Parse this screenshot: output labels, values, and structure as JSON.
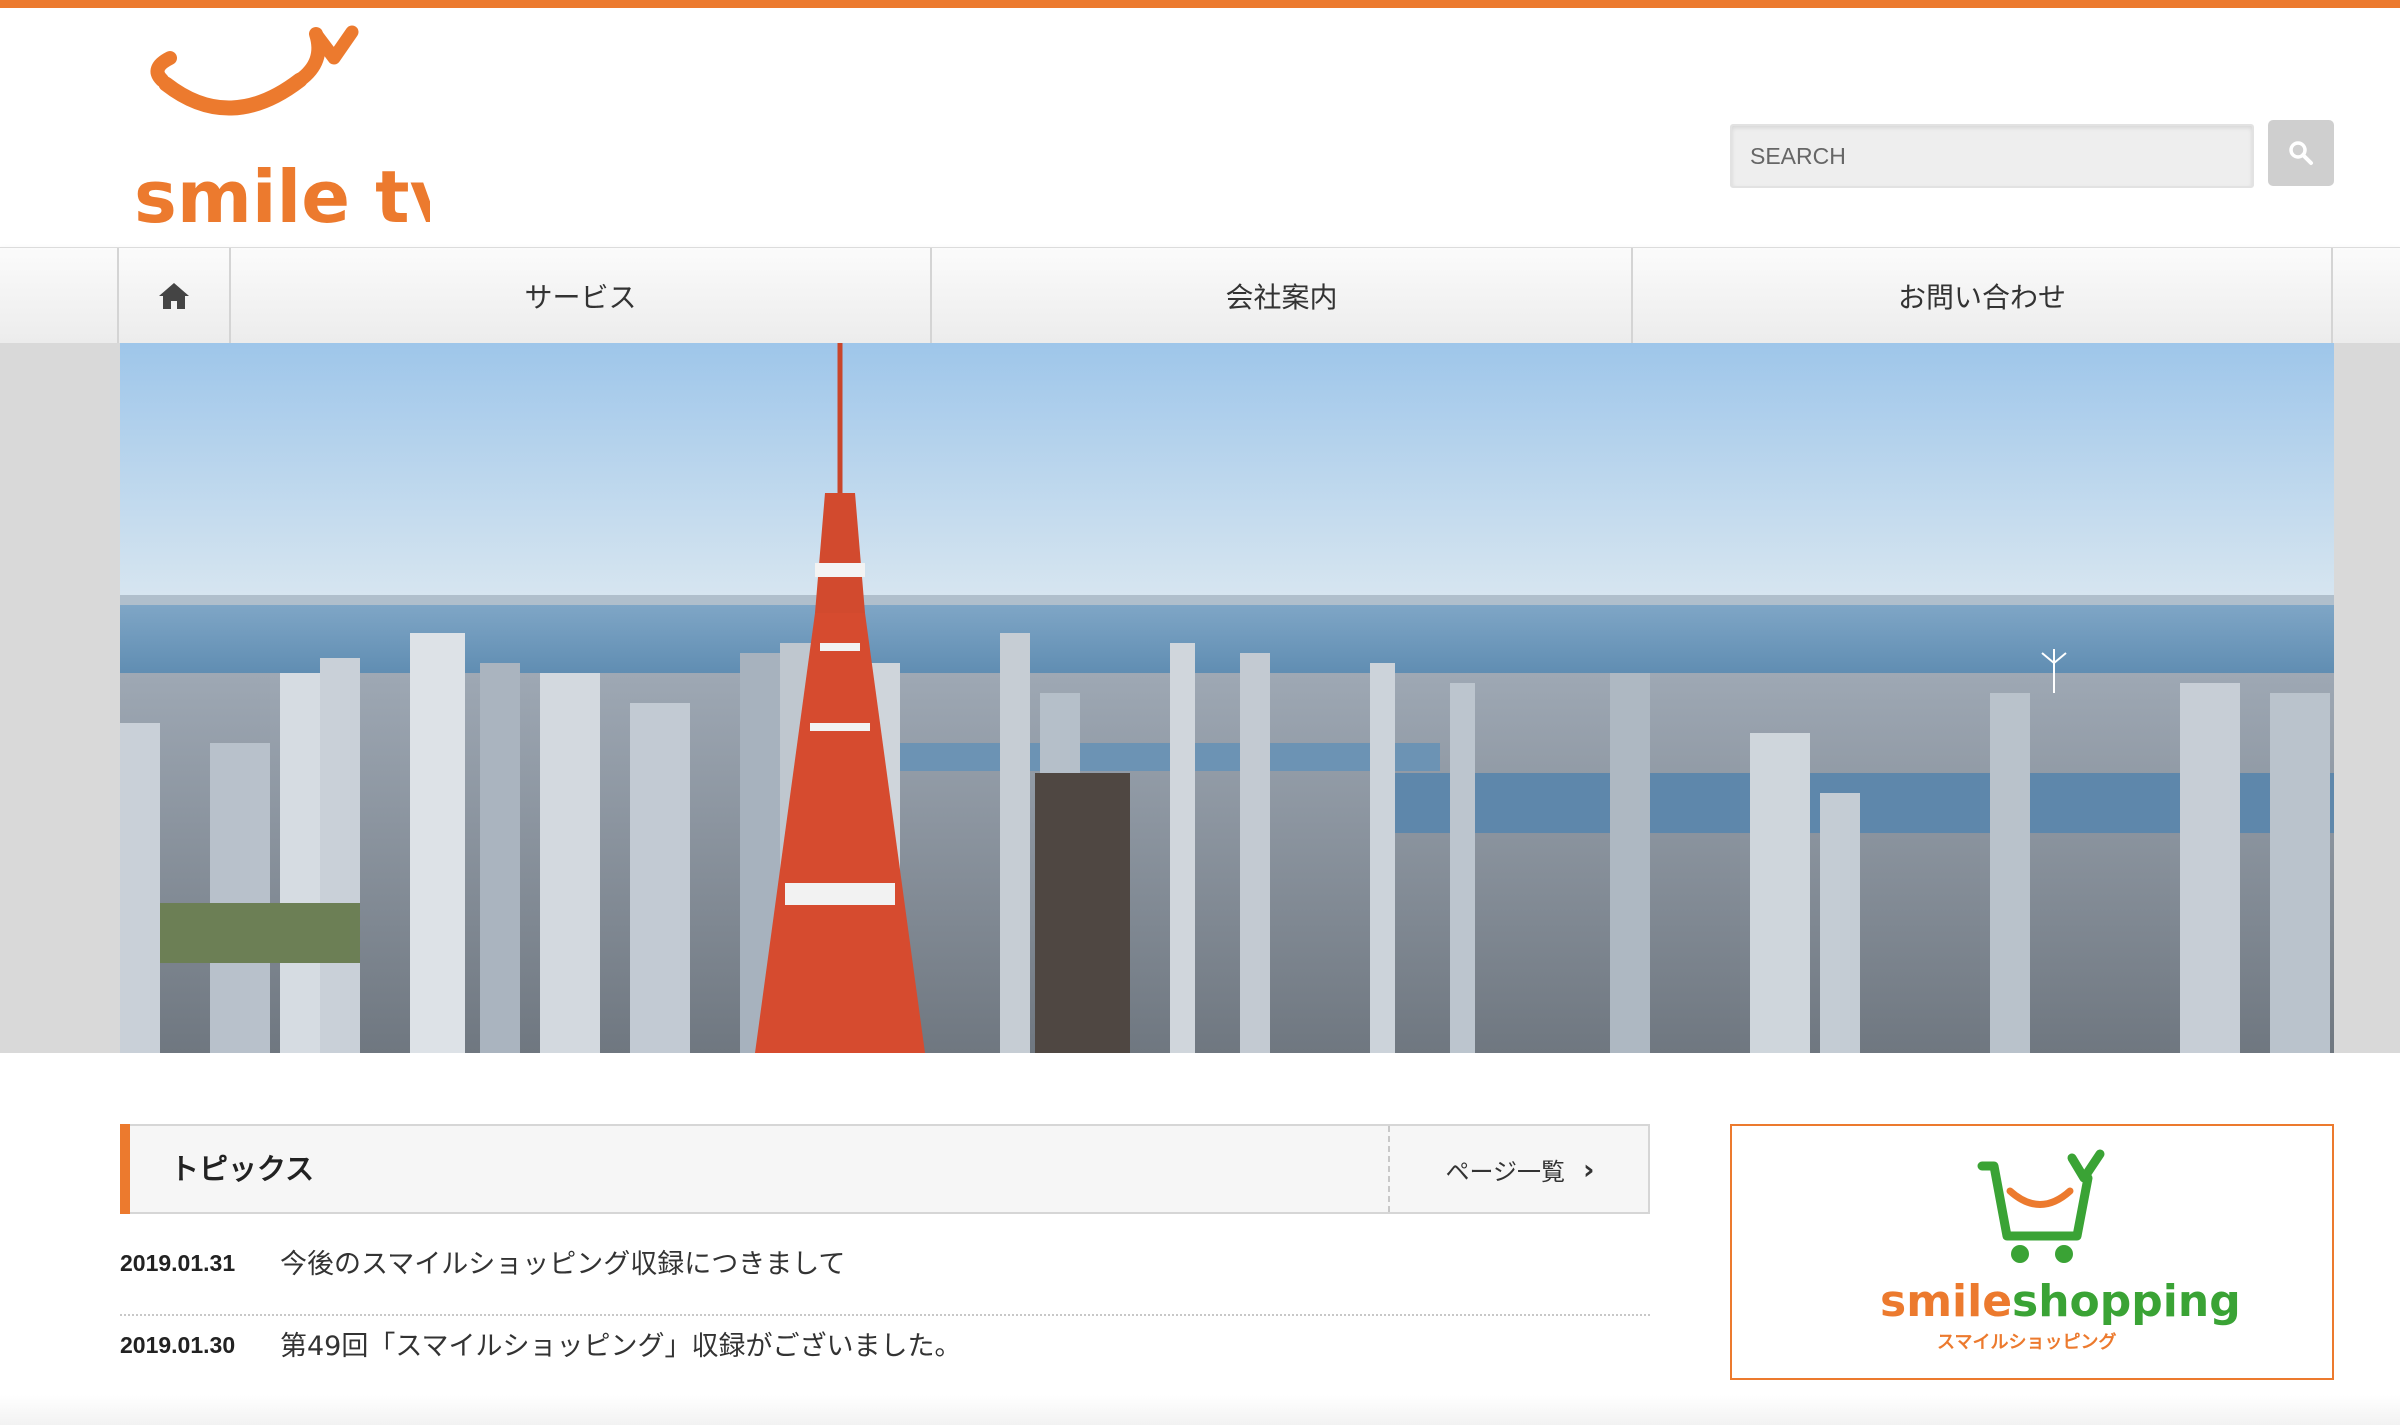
{
  "brand": {
    "name": "smile tv",
    "accent_color": "#ec7a2e"
  },
  "search": {
    "placeholder": "SEARCH",
    "button_icon": "search-icon"
  },
  "nav": {
    "home_icon": "home-icon",
    "items": [
      {
        "label": "サービス"
      },
      {
        "label": "会社案内"
      },
      {
        "label": "お問い合わせ"
      }
    ]
  },
  "hero": {
    "image": "tokyo-skyline-photo"
  },
  "topics": {
    "title": "トピックス",
    "more_label": "ページ一覧",
    "items": [
      {
        "date": "2019.01.31",
        "title": "今後のスマイルショッピング収録につきまして"
      },
      {
        "date": "2019.01.30",
        "title": "第49回「スマイルショッピング」収録がございました。"
      }
    ]
  },
  "banner": {
    "logo_text": "smileshopping",
    "logo_sub": "スマイルショッピング",
    "colors": {
      "green": "#3aa335",
      "orange": "#ec7a2e"
    }
  }
}
